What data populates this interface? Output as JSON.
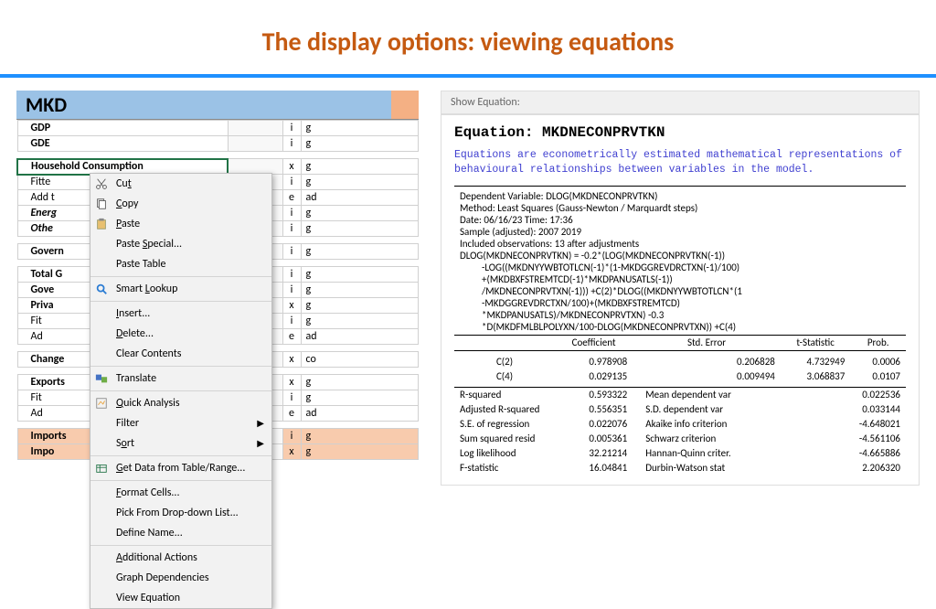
{
  "title": "The display options: viewing equations",
  "leftHeader": "MKD",
  "rows": [
    {
      "label": "GDP",
      "cls": "b",
      "c1": "i",
      "c2": "g"
    },
    {
      "label": "GDE",
      "cls": "b",
      "c1": "i",
      "c2": "g"
    },
    {
      "blank": true
    },
    {
      "label": "Household Consumption",
      "cls": "b",
      "sel": true,
      "c1": "x",
      "c2": "g"
    },
    {
      "label": "Fitte",
      "c1": "i",
      "c2": "g"
    },
    {
      "label": "Add t",
      "c1": "e",
      "c2": "ad"
    },
    {
      "label": "Energ",
      "cls": "b i",
      "c1": "i",
      "c2": "g"
    },
    {
      "label": "Othe",
      "cls": "b i",
      "c1": "i",
      "c2": "g"
    },
    {
      "blank": true
    },
    {
      "label": "Govern",
      "cls": "b",
      "c1": "i",
      "c2": "g"
    },
    {
      "blank": true
    },
    {
      "label": "Total G",
      "cls": "b",
      "c1": "i",
      "c2": "g"
    },
    {
      "label": "Gove",
      "cls": "b",
      "c1": "i",
      "c2": "g"
    },
    {
      "label": "Priva",
      "cls": "b",
      "c1": "x",
      "c2": "g"
    },
    {
      "label": "Fit",
      "c1": "i",
      "c2": "g"
    },
    {
      "label": "Ad",
      "c1": "e",
      "c2": "ad"
    },
    {
      "blank": true
    },
    {
      "label": "Change",
      "cls": "b",
      "c1": "x",
      "c2": "co"
    },
    {
      "blank": true
    },
    {
      "label": "Exports",
      "cls": "b",
      "c1": "x",
      "c2": "g"
    },
    {
      "label": "Fit",
      "c1": "i",
      "c2": "g"
    },
    {
      "label": "Ad",
      "c1": "e",
      "c2": "ad"
    },
    {
      "blank": true
    },
    {
      "label": "Imports",
      "cls": "b",
      "pink": true,
      "c1": "i",
      "c2": "g"
    },
    {
      "label": "Impo",
      "cls": "b",
      "pink": true,
      "c1": "x",
      "c2": "g"
    }
  ],
  "ctx": [
    {
      "t": "Cut",
      "u": "t",
      "icon": "cut"
    },
    {
      "t": "Copy",
      "u": "C",
      "icon": "copy"
    },
    {
      "t": "Paste",
      "u": "P",
      "icon": "paste"
    },
    {
      "t": "Paste Special...",
      "u": "S"
    },
    {
      "t": "Paste Table"
    },
    {
      "sep": true
    },
    {
      "t": "Smart Lookup",
      "u": "L",
      "icon": "lookup"
    },
    {
      "sep": true
    },
    {
      "t": "Insert...",
      "u": "I"
    },
    {
      "t": "Delete...",
      "u": "D"
    },
    {
      "t": "Clear Contents"
    },
    {
      "sep": true
    },
    {
      "t": "Translate",
      "icon": "trans"
    },
    {
      "sep": true
    },
    {
      "t": "Quick Analysis",
      "u": "Q",
      "icon": "qa"
    },
    {
      "t": "Filter",
      "u": "E",
      "arrow": true
    },
    {
      "t": "Sort",
      "u": "o",
      "arrow": true
    },
    {
      "sep": true
    },
    {
      "t": "Get Data from Table/Range...",
      "u": "G",
      "icon": "data"
    },
    {
      "sep": true
    },
    {
      "t": "Format Cells...",
      "u": "F"
    },
    {
      "t": "Pick From Drop-down List...",
      "u": "K"
    },
    {
      "t": "Define Name..."
    },
    {
      "sep": true
    },
    {
      "t": "Additional Actions",
      "u": "A"
    },
    {
      "t": "Graph Dependencies"
    },
    {
      "t": "View Equation"
    }
  ],
  "showEq": {
    "header": "Show Equation:",
    "title": "Equation: MKDNECONPRVTKN",
    "desc": "Equations are econometrically estimated mathematical representations of behavioural relationships between variables in the model.",
    "meta": [
      "Dependent Variable: DLOG(MKDNECONPRVTKN)",
      "Method: Least Squares (Gauss-Newton / Marquardt steps)",
      "Date: 06/16/23   Time: 17:36",
      "Sample (adjusted): 2007 2019",
      "Included observations: 13 after adjustments",
      "DLOG(MKDNECONPRVTKN) = -0.2*(LOG(MKDNECONPRVTKN(-1))"
    ],
    "eqLines": [
      "-LOG((MKDNYYWBTOTLCN(-1)*(1-MKDGGREVDRCTXN(-1)/100)",
      "+(MKDBXFSTREMTCD(-1)*MKDPANUSATLS(-1))",
      "/MKDNECONPRVTXN(-1))) +C(2)*DLOG((MKDNYYWBTOTLCN*(1",
      "-MKDGGREVDRCTXN/100)+(MKDBXFSTREMTCD)",
      "*MKDPANUSATLS)/MKDNECONPRVTXN) -0.3",
      "*D(MKDFMLBLPOLYXN/100-DLOG(MKDNECONPRVTXN)) +C(4)"
    ],
    "coefHdr": [
      "",
      "Coefficient",
      "Std. Error",
      "t-Statistic",
      "Prob."
    ],
    "coefRows": [
      [
        "C(2)",
        "0.978908",
        "0.206828",
        "4.732949",
        "0.0006"
      ],
      [
        "C(4)",
        "0.029135",
        "0.009494",
        "3.068837",
        "0.0107"
      ]
    ],
    "statsLeft": [
      [
        "R-squared",
        "0.593322"
      ],
      [
        "Adjusted R-squared",
        "0.556351"
      ],
      [
        "S.E. of regression",
        "0.022076"
      ],
      [
        "Sum squared resid",
        "0.005361"
      ],
      [
        "Log likelihood",
        "32.21214"
      ],
      [
        "F-statistic",
        "16.04841"
      ]
    ],
    "statsRight": [
      [
        "Mean dependent var",
        "0.022536"
      ],
      [
        "S.D. dependent var",
        "0.033144"
      ],
      [
        "Akaike info criterion",
        "-4.648021"
      ],
      [
        "Schwarz criterion",
        "-4.561106"
      ],
      [
        "Hannan-Quinn criter.",
        "-4.665886"
      ],
      [
        "Durbin-Watson stat",
        "2.206320"
      ]
    ]
  }
}
